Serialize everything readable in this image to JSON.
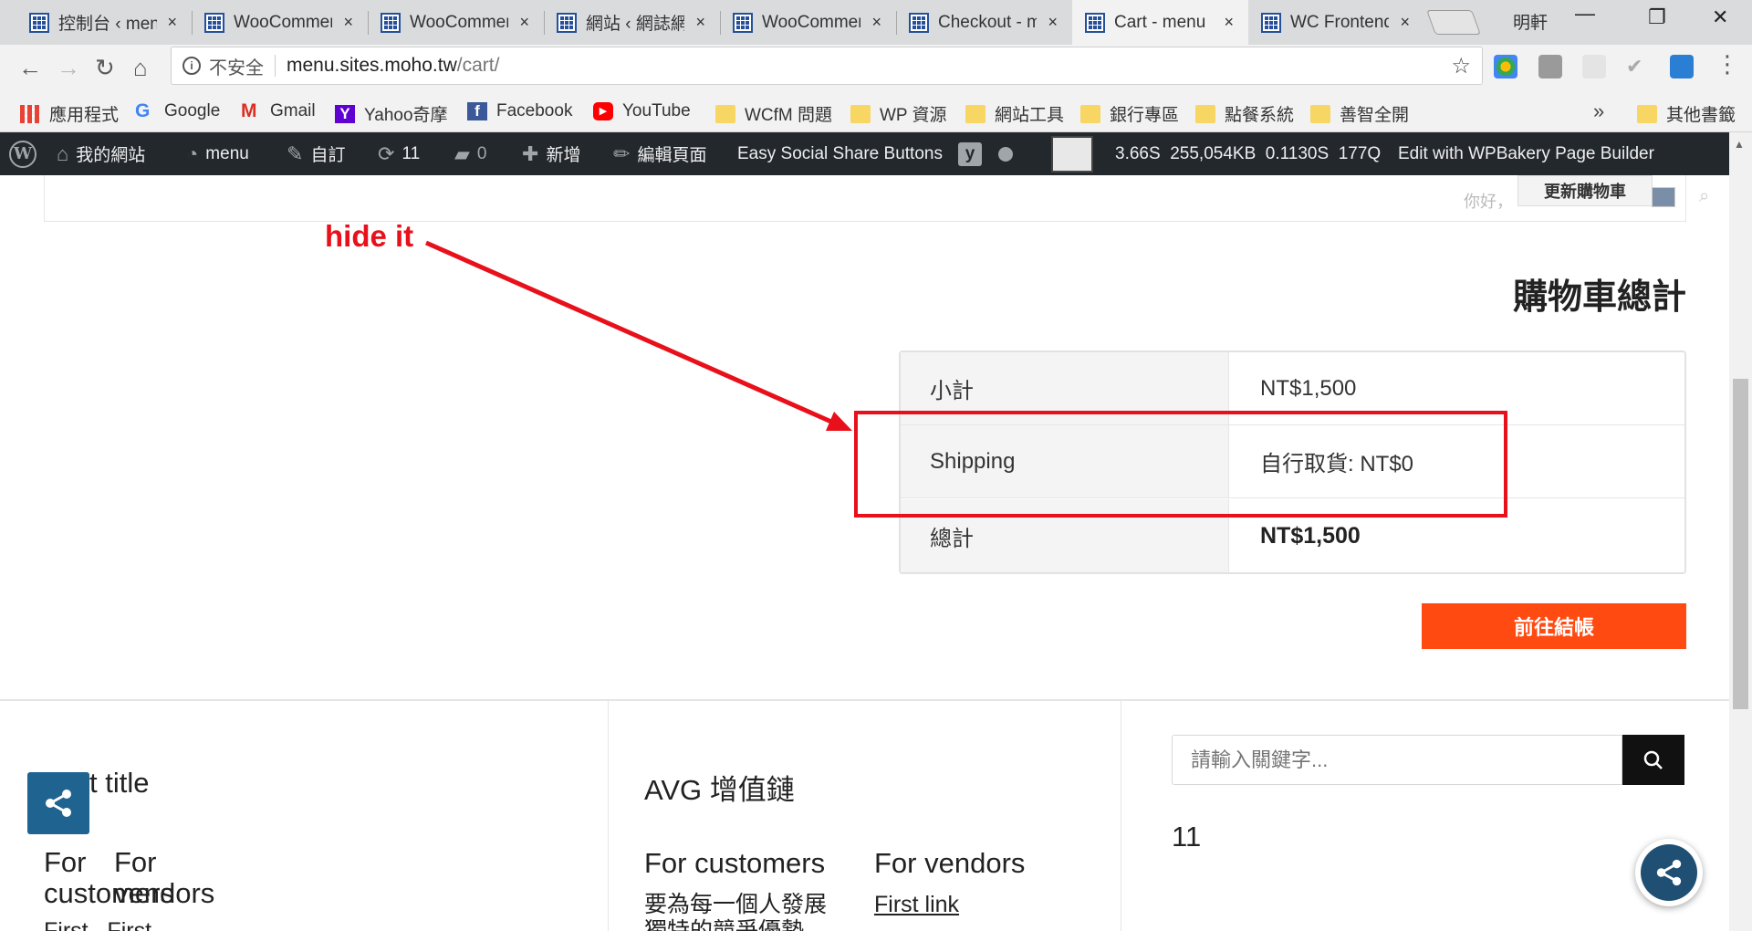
{
  "browser": {
    "tabs": [
      {
        "title": "控制台 ‹ menu"
      },
      {
        "title": "WooCommerce"
      },
      {
        "title": "WooCommerce"
      },
      {
        "title": "網站 ‹ 網誌網路"
      },
      {
        "title": "WooCommerce"
      },
      {
        "title": "Checkout - menu"
      },
      {
        "title": "Cart - menu"
      },
      {
        "title": "WC Frontend"
      }
    ],
    "close_glyph": "×",
    "profile_name": "明軒",
    "security_label": "不安全",
    "url_host": "menu.sites.moho.tw",
    "url_path": "/cart/",
    "bookmarks": [
      {
        "label": "應用程式",
        "icon": "apps-grid-icon"
      },
      {
        "label": "Google",
        "icon": "google-icon"
      },
      {
        "label": "Gmail",
        "icon": "gmail-icon"
      },
      {
        "label": "Yahoo奇摩",
        "icon": "yahoo-icon"
      },
      {
        "label": "Facebook",
        "icon": "facebook-icon"
      },
      {
        "label": "YouTube",
        "icon": "youtube-icon"
      },
      {
        "label": "WCfM 問題",
        "icon": "folder-icon"
      },
      {
        "label": "WP 資源",
        "icon": "folder-icon"
      },
      {
        "label": "網站工具",
        "icon": "folder-icon"
      },
      {
        "label": "銀行專區",
        "icon": "folder-icon"
      },
      {
        "label": "點餐系統",
        "icon": "folder-icon"
      },
      {
        "label": "善智全開",
        "icon": "folder-icon"
      }
    ],
    "bookmarks_overflow": "»",
    "other_bookmarks": "其他書籤"
  },
  "adminbar": {
    "site_name": "我的網站",
    "dashboard_label": "menu",
    "customize_label": "自訂",
    "updates_count": "11",
    "comments_count": "0",
    "new_label": "新增",
    "edit_label": "編輯頁面",
    "social_label": "Easy Social Share Buttons",
    "stats": "3.66S  255,054KB  0.1130S  177Q",
    "wpbakery_label": "Edit with WPBakery Page Builder"
  },
  "page": {
    "update_cart_label": "更新購物車",
    "greeting": "你好，",
    "totals_title": "購物車總計",
    "rows": [
      {
        "label": "小計",
        "value": "NT$1,500"
      },
      {
        "label": "Shipping",
        "value": "自行取貨: NT$0"
      },
      {
        "label": "總計",
        "value": "NT$1,500"
      }
    ],
    "checkout_label": "前往結帳",
    "annotation": "hide it",
    "colors": {
      "accent": "#ff4b12",
      "annotation": "#e8101a",
      "adminbar": "#23282d",
      "share": "#1f6391"
    }
  },
  "footer": {
    "col1_title": "t title",
    "col1_for_customers": "For customers",
    "col1_for_vendors": "For vendors",
    "col1_links": "First   First",
    "col2_title": "AVG 增值鏈",
    "col2_customers_heading": "For customers",
    "col2_customers_text": "要為每一個人發展獨特的競爭優勢，要為",
    "col2_vendors_heading": "For vendors",
    "col2_vendors_link": "First link",
    "search_placeholder": "請輸入關鍵字...",
    "widget_number": "11"
  }
}
